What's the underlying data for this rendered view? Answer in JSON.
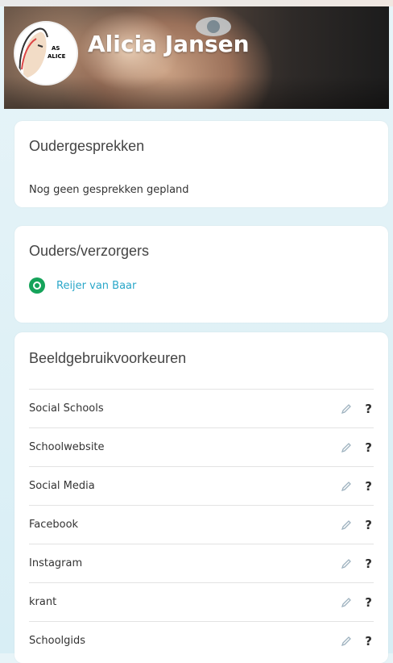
{
  "header": {
    "partial_text": "........ ... ..... . ...... .. .. ... ...... ... ... ... ...",
    "student_name": "Alicia Jansen",
    "avatar_text": [
      "AS",
      "ALICE"
    ]
  },
  "parent_meetings": {
    "title": "Oudergesprekken",
    "empty_text": "Nog geen gesprekken gepland"
  },
  "guardians": {
    "title": "Ouders/verzorgers",
    "items": [
      {
        "name": "Reijer van Baar",
        "status_color": "#15a35a"
      }
    ]
  },
  "image_preferences": {
    "title": "Beeldgebruikvoorkeuren",
    "items": [
      {
        "label": "Social Schools",
        "help": "?"
      },
      {
        "label": "Schoolwebsite",
        "help": "?"
      },
      {
        "label": "Social Media",
        "help": "?"
      },
      {
        "label": "Facebook",
        "help": "?"
      },
      {
        "label": "Instagram",
        "help": "?"
      },
      {
        "label": "krant",
        "help": "?"
      },
      {
        "label": "Schoolgids",
        "help": "?"
      }
    ]
  },
  "colors": {
    "background": "#ddf0f6",
    "accent_link": "#2aa7c9",
    "status_green": "#15a35a"
  },
  "icons": {
    "edit": "pencil-icon",
    "help": "help-icon",
    "status": "status-icon"
  }
}
